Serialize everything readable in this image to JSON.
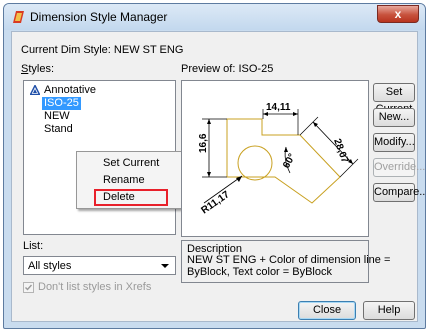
{
  "window": {
    "title": "Dimension Style Manager",
    "close_glyph": "x"
  },
  "current_style": {
    "label": "Current Dim Style: NEW ST ENG"
  },
  "styles": {
    "label": "Styles:",
    "items": [
      "Annotative",
      "ISO-25",
      "NEW",
      "Stand"
    ],
    "selected": "ISO-25"
  },
  "context_menu": {
    "items": [
      "Set Current",
      "Rename",
      "Delete"
    ],
    "highlighted": "Delete"
  },
  "preview": {
    "label": "Preview of: ISO-25",
    "dimensions": {
      "top": "14,11",
      "left": "16,6",
      "diagonal": "28,07",
      "angle": "60°",
      "radius": "R11,17"
    }
  },
  "buttons": {
    "set_current": "Set Current",
    "new": "New...",
    "modify": "Modify...",
    "override": "Override...",
    "compare": "Compare...",
    "close": "Close",
    "help": "Help"
  },
  "list": {
    "label": "List:",
    "selected": "All styles"
  },
  "xrefs": {
    "label": "Don't list styles in Xrefs",
    "checked": true
  },
  "description": {
    "label": "Description",
    "line1": "NEW ST ENG + Color of dimension line =",
    "line2": "ByBlock, Text color = ByBlock"
  },
  "colors": {
    "selection": "#3399ff",
    "highlight_box": "#e8202a",
    "drawing_line": "#c8a020",
    "dimension": "#000000"
  },
  "icons": {
    "app": "autocad-icon",
    "annotative": "annotative-triangle-icon"
  }
}
